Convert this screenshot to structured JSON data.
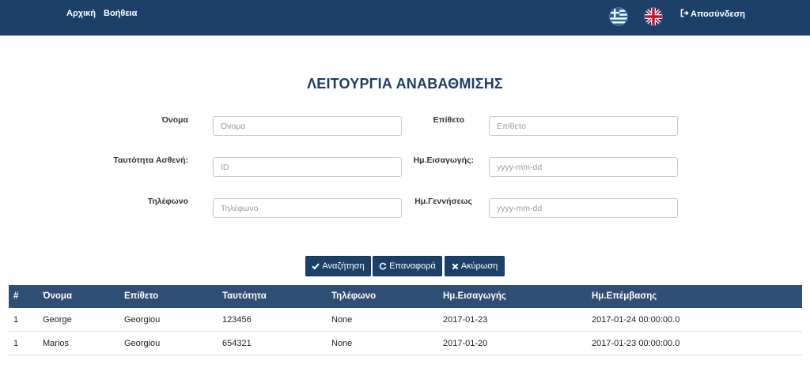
{
  "nav": {
    "home": "Αρχική",
    "help": "Βοήθεια",
    "logout": "Αποσύνδεση"
  },
  "flags": [
    "greece-flag-icon",
    "uk-flag-icon"
  ],
  "title": "ΛΕΙΤΟΥΡΓΙΑ ΑΝΑΒΑΘΜΙΣΗΣ",
  "form": {
    "first_name": {
      "label": "Όνομα",
      "placeholder": "Όνομα",
      "value": ""
    },
    "last_name": {
      "label": "Επίθετο",
      "placeholder": "Επίθετο",
      "value": ""
    },
    "patient_id": {
      "label": "Ταυτότητα Ασθενή:",
      "placeholder": "ID",
      "value": ""
    },
    "admission_date": {
      "label": "Ημ.Εισαγωγής:",
      "placeholder": "yyyy-mm-dd",
      "value": ""
    },
    "phone": {
      "label": "Τηλέφωνο",
      "placeholder": "Τηλέφωνο",
      "value": ""
    },
    "birth_date": {
      "label": "Ημ.Γεννήσεως",
      "placeholder": "yyyy-mm-dd",
      "value": ""
    }
  },
  "buttons": {
    "search": "Αναζήτηση",
    "reset": "Επαναφορά",
    "cancel": "Ακύρωση"
  },
  "colors": {
    "navbar": "#1d4068",
    "title": "#1f3d64",
    "table_header": "#2f4e73",
    "button": "#1d4068"
  },
  "table": {
    "headers": [
      "#",
      "Όνομα",
      "Επίθετο",
      "Ταυτότητα",
      "Τηλέφωνο",
      "Ημ.Εισαγωγής",
      "Ημ.Επέμβασης"
    ],
    "rows": [
      [
        "1",
        "George",
        "Georgiou",
        "123456",
        "None",
        "2017-01-23",
        "2017-01-24 00:00:00.0"
      ],
      [
        "1",
        "Marios",
        "Georgiou",
        "654321",
        "None",
        "2017-01-20",
        "2017-01-23 00:00:00.0"
      ]
    ]
  }
}
